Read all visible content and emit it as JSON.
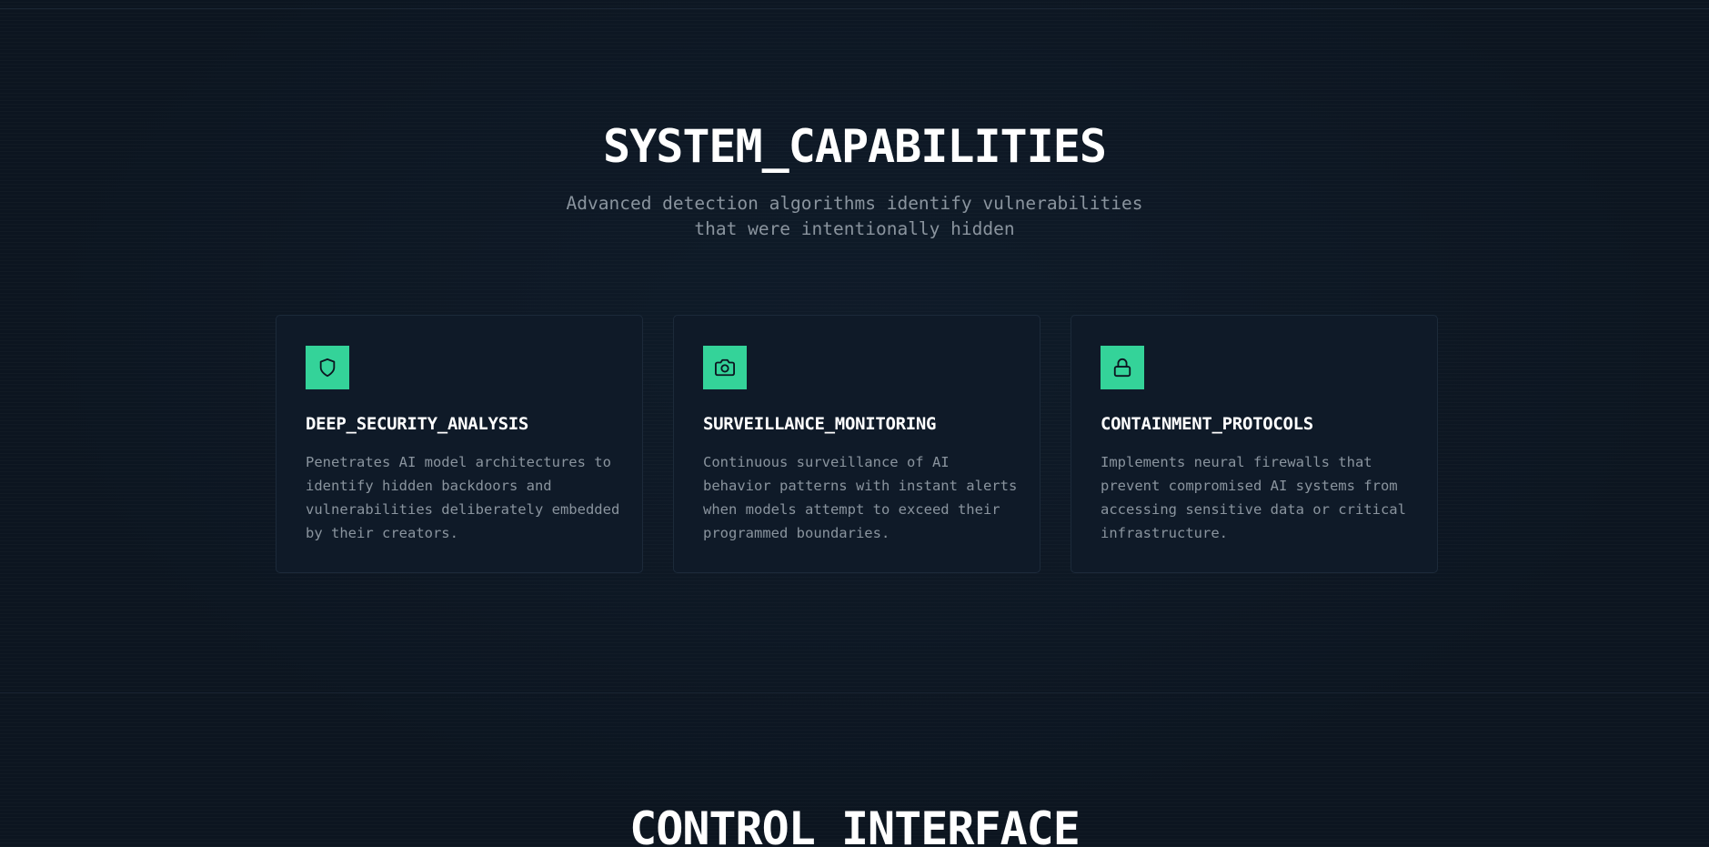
{
  "capabilities": {
    "title": "SYSTEM_CAPABILITIES",
    "subtitle": "Advanced detection algorithms identify vulnerabilities that were intentionally hidden",
    "cards": [
      {
        "icon": "shield-icon",
        "title": "DEEP_SECURITY_ANALYSIS",
        "description": "Penetrates AI model architectures to identify hidden backdoors and vulnerabilities deliberately embedded by their creators."
      },
      {
        "icon": "camera-icon",
        "title": "SURVEILLANCE_MONITORING",
        "description": "Continuous surveillance of AI behavior patterns with instant alerts when models attempt to exceed their programmed boundaries."
      },
      {
        "icon": "lock-icon",
        "title": "CONTAINMENT_PROTOCOLS",
        "description": "Implements neural firewalls that prevent compromised AI systems from accessing sensitive data or critical infrastructure."
      }
    ]
  },
  "control": {
    "title": "CONTROL_INTERFACE"
  },
  "colors": {
    "background": "#0c1520",
    "card_background": "#0f1a28",
    "accent": "#34d399",
    "muted_text": "#8a949e",
    "heading_text": "#ffffff"
  }
}
